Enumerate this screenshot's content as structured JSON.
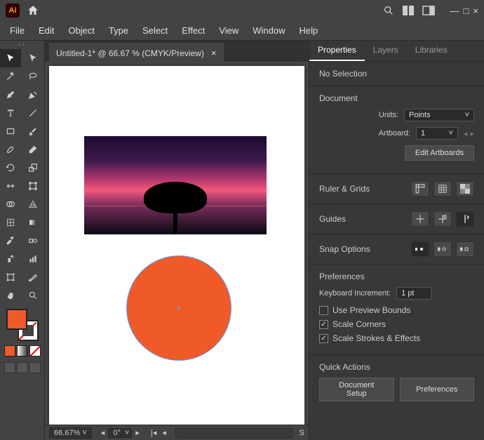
{
  "titlebar": {
    "app_badge": "Ai"
  },
  "window_controls": {
    "minimize": "—",
    "maximize": "□",
    "close": "×"
  },
  "menu": {
    "file": "File",
    "edit": "Edit",
    "object": "Object",
    "type": "Type",
    "select": "Select",
    "effect": "Effect",
    "view": "View",
    "window": "Window",
    "help": "Help"
  },
  "doc_tab": {
    "label": "Untitled-1* @ 66.67 % (CMYK/Preview)",
    "close": "×"
  },
  "canvas": {
    "circle_fill": "#f05a28"
  },
  "swatch": {
    "fill": "#f05a28",
    "mini_fill": "#f05a28"
  },
  "status": {
    "zoom": "66.67%",
    "rotation": "0°"
  },
  "panel": {
    "tabs": {
      "properties": "Properties",
      "layers": "Layers",
      "libraries": "Libraries"
    },
    "selection": "No Selection",
    "document_label": "Document",
    "units_label": "Units:",
    "units_value": "Points",
    "artboard_label": "Artboard:",
    "artboard_value": "1",
    "edit_artboards": "Edit Artboards",
    "ruler_grids": "Ruler & Grids",
    "guides": "Guides",
    "snap_options": "Snap Options",
    "preferences_label": "Preferences",
    "key_increment_label": "Keyboard Increment:",
    "key_increment_value": "1 pt",
    "use_preview_bounds": "Use Preview Bounds",
    "scale_corners": "Scale Corners",
    "scale_strokes": "Scale Strokes & Effects",
    "quick_actions": "Quick Actions",
    "document_setup": "Document Setup",
    "preferences_btn": "Preferences"
  }
}
